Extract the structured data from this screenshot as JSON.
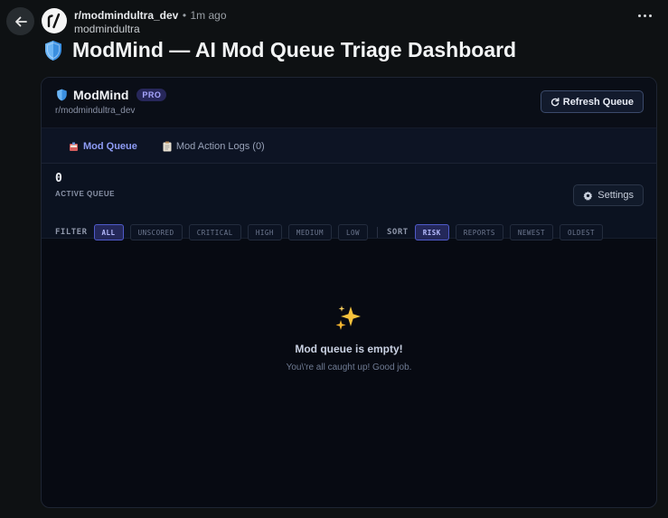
{
  "post": {
    "subreddit": "r/modmindultra_dev",
    "separator": "•",
    "time": "1m ago",
    "author": "modmindultra",
    "title": "ModMind — AI Mod Queue Triage Dashboard"
  },
  "app": {
    "brand": "ModMind",
    "badge": "PRO",
    "subreddit": "r/modmindultra_dev",
    "refresh_label": "Refresh Queue",
    "tabs": [
      {
        "label": "Mod Queue",
        "icon": "inbox-icon"
      },
      {
        "label": "Mod Action Logs (0)",
        "icon": "clipboard-icon"
      }
    ],
    "queue_count": "0",
    "queue_label": "ACTIVE QUEUE",
    "settings_label": "Settings",
    "filter_label": "FILTER",
    "filters": [
      "ALL",
      "UNSCORED",
      "CRITICAL",
      "HIGH",
      "MEDIUM",
      "LOW"
    ],
    "sort_label": "SORT",
    "sorts": [
      "RISK",
      "REPORTS",
      "NEWEST",
      "OLDEST"
    ],
    "empty_title": "Mod queue is empty!",
    "empty_sub": "You\\'re all caught up! Good job."
  },
  "colors": {
    "background": "#0e1113",
    "accent": "#7f8ef5"
  }
}
